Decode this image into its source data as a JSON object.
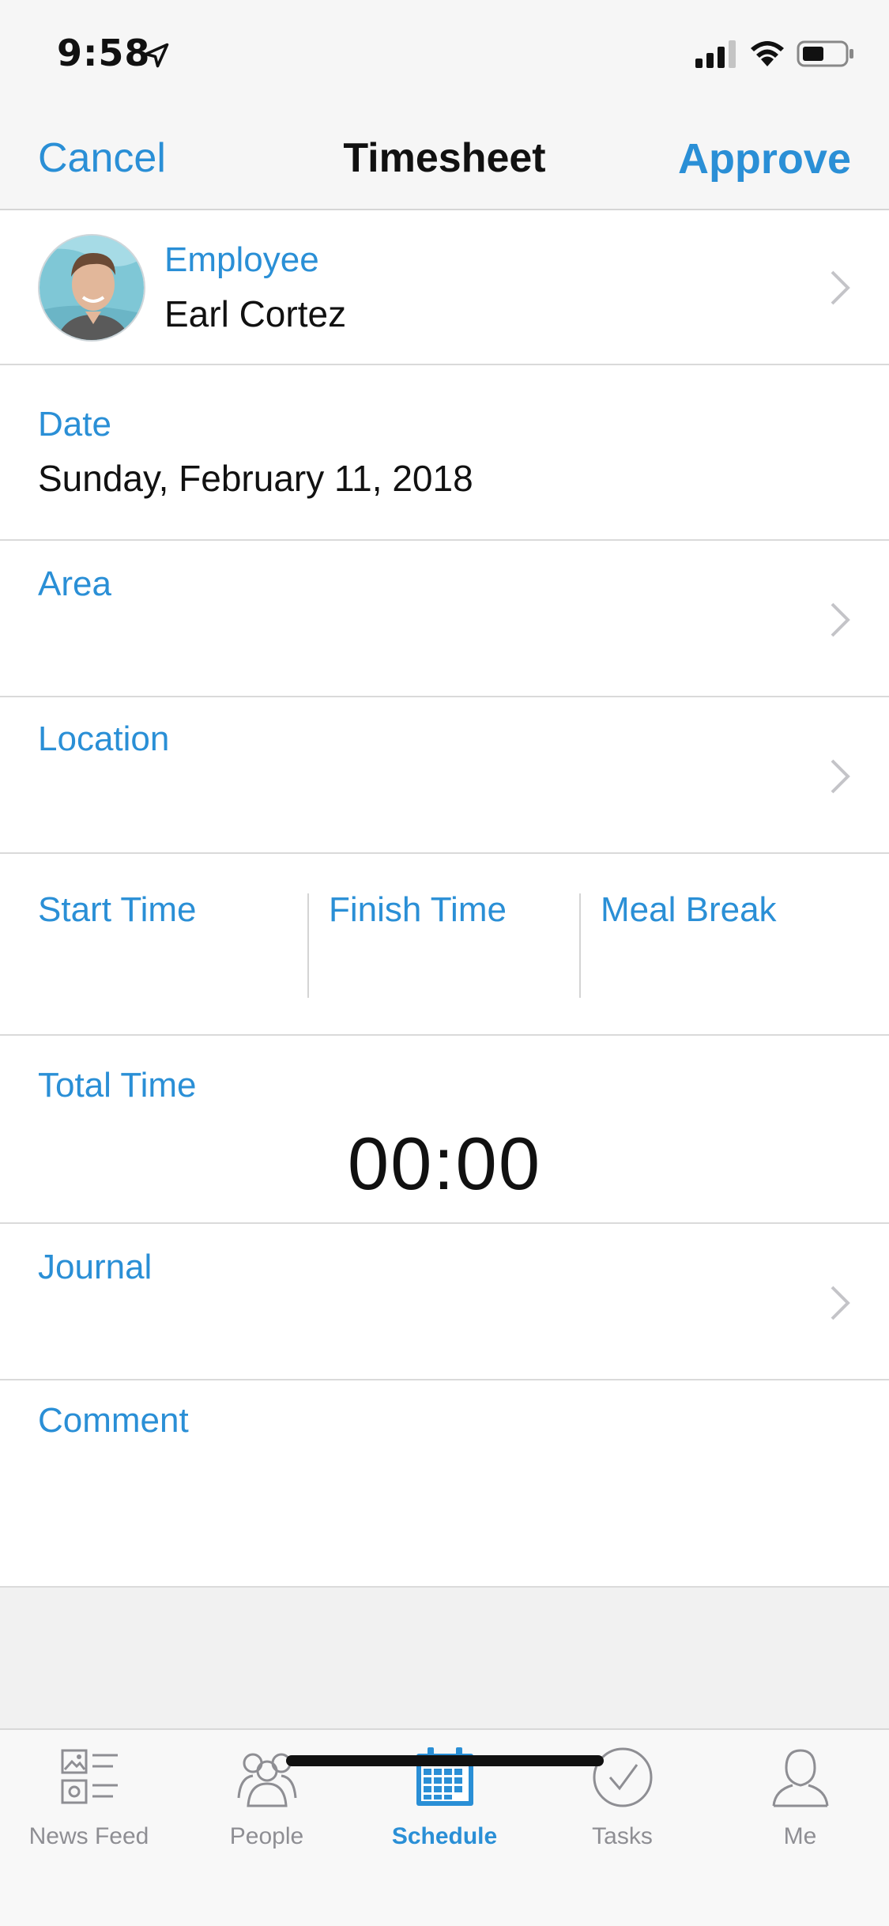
{
  "status": {
    "time": "9:58"
  },
  "nav": {
    "cancel": "Cancel",
    "title": "Timesheet",
    "approve": "Approve"
  },
  "employee": {
    "label": "Employee",
    "name": "Earl Cortez"
  },
  "date": {
    "label": "Date",
    "value": "Sunday, February 11, 2018"
  },
  "area": {
    "label": "Area"
  },
  "location": {
    "label": "Location"
  },
  "times": {
    "start_label": "Start Time",
    "finish_label": "Finish Time",
    "meal_label": "Meal Break"
  },
  "total": {
    "label": "Total Time",
    "value": "00:00"
  },
  "journal": {
    "label": "Journal"
  },
  "comment": {
    "label": "Comment"
  },
  "tabs": [
    {
      "label": "News Feed",
      "icon": "news-feed-icon"
    },
    {
      "label": "People",
      "icon": "people-icon"
    },
    {
      "label": "Schedule",
      "icon": "calendar-icon",
      "active": true
    },
    {
      "label": "Tasks",
      "icon": "check-circle-icon"
    },
    {
      "label": "Me",
      "icon": "person-icon"
    }
  ],
  "colors": {
    "accent": "#2a8fd6",
    "text": "#111111",
    "inactive": "#8e8e93",
    "separator": "#dadada"
  }
}
